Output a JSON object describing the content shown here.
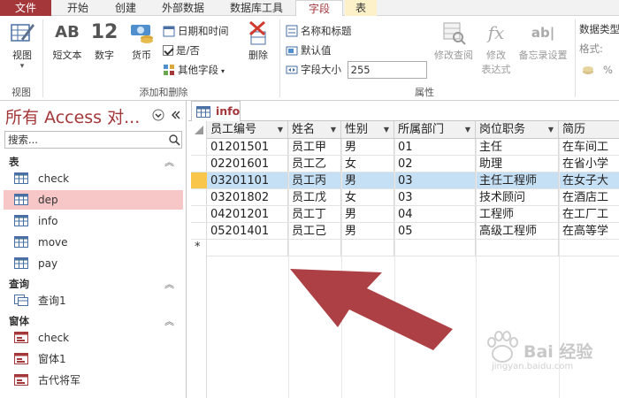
{
  "ribbon_tabs": [
    "文件",
    "开始",
    "创建",
    "外部数据",
    "数据库工具",
    "字段",
    "表"
  ],
  "ribbon": {
    "view_label": "视图",
    "short_text_label": "短文本",
    "number_label": "数字",
    "currency_label": "货币",
    "datetime_label": "日期和时间",
    "yesno_label": "是/否",
    "other_fields_label": "其他字段",
    "delete_label": "删除",
    "name_caption_label": "名称和标题",
    "default_value_label": "默认值",
    "field_size_label": "字段大小",
    "field_size_value": "255",
    "modify_lookup_label": "修改查阅",
    "modify_expression_label1": "修改",
    "modify_expression_label2": "表达式",
    "memo_settings_label": "备忘录设置",
    "data_type_label": "数据类型",
    "format_label": "格式:",
    "percent_label": "%",
    "group_view": "视图",
    "group_add_delete": "添加和删除",
    "group_properties": "属性",
    "ab_glyph": "AB",
    "number_glyph": "12",
    "fx_glyph": "fx",
    "abl_glyph": "ab|"
  },
  "nav": {
    "title": "所有 Access 对...",
    "search_placeholder": "搜索...",
    "sections": [
      {
        "label": "表",
        "items": [
          "check",
          "dep",
          "info",
          "move",
          "pay"
        ]
      },
      {
        "label": "查询",
        "items": [
          "查询1"
        ]
      },
      {
        "label": "窗体",
        "items": [
          "check",
          "窗体1",
          "古代将军"
        ]
      }
    ]
  },
  "document_tab": "info",
  "table": {
    "columns": [
      "员工编号",
      "姓名",
      "性别",
      "所属部门",
      "岗位职务",
      "简历"
    ],
    "rows": [
      [
        "01201501",
        "员工甲",
        "男",
        "01",
        "主任",
        "在车间工"
      ],
      [
        "02201601",
        "员工乙",
        "女",
        "02",
        "助理",
        "在省小学"
      ],
      [
        "03201101",
        "员工丙",
        "男",
        "03",
        "主任工程师",
        "在女子大"
      ],
      [
        "03201802",
        "员工戊",
        "女",
        "03",
        "技术顾问",
        "在酒店工"
      ],
      [
        "04201201",
        "员工丁",
        "男",
        "04",
        "工程师",
        "在工厂工"
      ],
      [
        "05201401",
        "员工己",
        "男",
        "05",
        "高级工程师",
        "在高等学"
      ]
    ],
    "selected_row": 2,
    "new_record_marker": "*"
  },
  "watermark": {
    "text": "Bai 经验",
    "sub": "jingyan.baidu.com"
  },
  "colors": {
    "accent": "#a4373a",
    "selection": "#f7c6c7",
    "row_highlight": "#c5dff5",
    "arrow": "#a73236"
  }
}
